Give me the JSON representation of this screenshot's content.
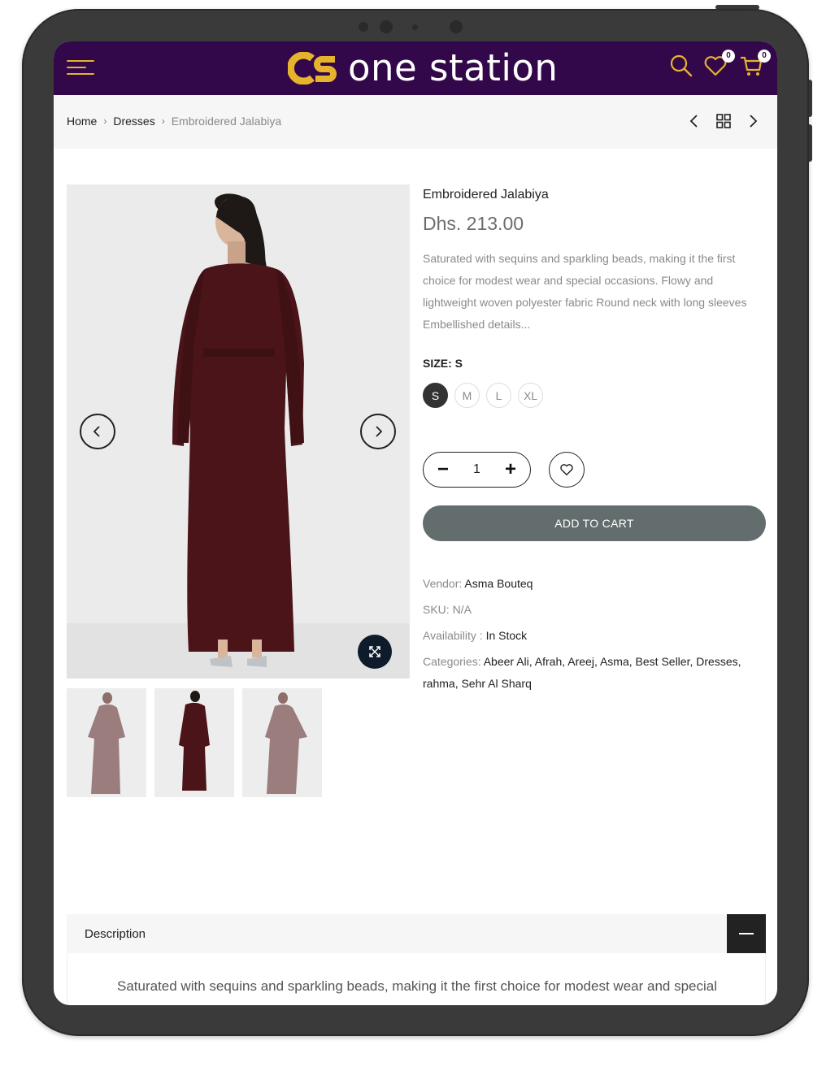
{
  "header": {
    "logo_text": "one station",
    "wishlist_count": "0",
    "cart_count": "0",
    "colors": {
      "bar": "#33084a",
      "accent": "#e6b42c"
    },
    "icons": [
      "menu-icon",
      "search-icon",
      "heart-icon",
      "cart-icon"
    ]
  },
  "breadcrumb": {
    "home": "Home",
    "category": "Dresses",
    "current": "Embroidered Jalabiya"
  },
  "product": {
    "title": "Embroidered Jalabiya",
    "price": "Dhs. 213.00",
    "description": "Saturated with sequins and sparkling beads, making it the first choice for modest wear and special occasions.   Flowy and lightweight woven polyester fabric Round neck with long sleeves Embellished details...",
    "size_label": "SIZE: S",
    "sizes": [
      "S",
      "M",
      "L",
      "XL"
    ],
    "selected_size": "S",
    "quantity": "1",
    "add_to_cart": "ADD TO CART",
    "dress_color": "#4a1418"
  },
  "meta": {
    "vendor_key": "Vendor:",
    "vendor": "Asma Bouteq",
    "sku": "SKU: N/A",
    "availability_key": "Availability :",
    "availability": "In Stock",
    "categories_key": "Categories:",
    "categories": [
      "Abeer Ali",
      "Afrah",
      "Areej",
      "Asma",
      "Best Seller",
      "Dresses",
      "rahma",
      "Sehr Al Sharq"
    ]
  },
  "description_section": {
    "title": "Description",
    "text": "Saturated with sequins and sparkling beads, making it the first choice for modest wear and special"
  }
}
